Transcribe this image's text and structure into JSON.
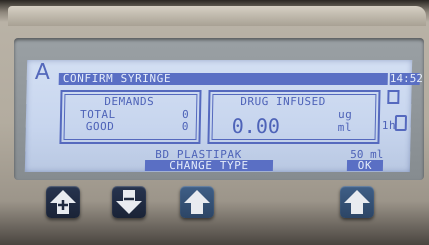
{
  "screen": {
    "mode_letter": "A",
    "title": "CONFIRM SYRINGE",
    "clock": "14:52",
    "demands": {
      "heading": "DEMANDS",
      "total_label": "TOTAL",
      "total_value": "0",
      "good_label": "GOOD",
      "good_value": "0"
    },
    "drug_infused": {
      "heading": "DRUG INFUSED",
      "value": "0.00",
      "unit_top": "ug",
      "unit_bottom": "ml",
      "period": "1h"
    },
    "syringe": {
      "name": "BD PLASTIPAK",
      "volume": "50 ml"
    },
    "softkeys": {
      "left": "CHANGE TYPE",
      "right": "OK"
    }
  },
  "keypad": [
    {
      "icon": "plus-arrow-up-icon"
    },
    {
      "icon": "minus-arrow-down-icon"
    },
    {
      "icon": "arrow-up-icon"
    },
    {
      "icon": "arrow-up-icon"
    }
  ],
  "colors": {
    "lcd_background": "#cddaf1",
    "lcd_text": "#4e63b8",
    "highlight_bar": "#5a6fc4",
    "dark_key": "#1f2a40",
    "blue_key": "#355277"
  }
}
